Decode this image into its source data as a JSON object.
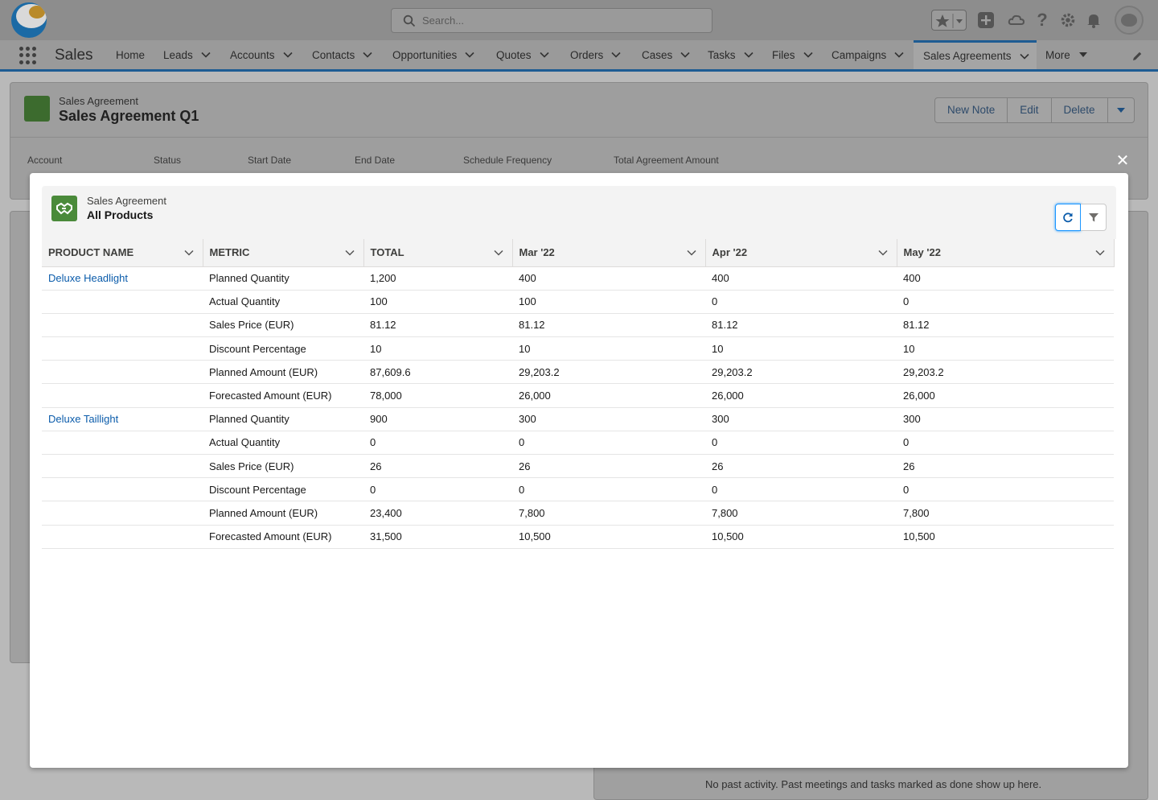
{
  "header": {
    "search_placeholder": "Search..."
  },
  "nav": {
    "app_name": "Sales",
    "items": [
      {
        "label": "Home",
        "has_menu": false
      },
      {
        "label": "Leads",
        "has_menu": true
      },
      {
        "label": "Accounts",
        "has_menu": true
      },
      {
        "label": "Contacts",
        "has_menu": true
      },
      {
        "label": "Opportunities",
        "has_menu": true
      },
      {
        "label": "Quotes",
        "has_menu": true
      },
      {
        "label": "Orders",
        "has_menu": true
      },
      {
        "label": "Cases",
        "has_menu": true
      },
      {
        "label": "Tasks",
        "has_menu": true
      },
      {
        "label": "Files",
        "has_menu": true
      },
      {
        "label": "Campaigns",
        "has_menu": true
      },
      {
        "label": "Sales Agreements",
        "has_menu": true,
        "active": true
      },
      {
        "label": "More",
        "has_menu": true
      }
    ]
  },
  "record": {
    "type_label": "Sales Agreement",
    "name": "Sales Agreement Q1",
    "actions": [
      "New Note",
      "Edit",
      "Delete"
    ],
    "fields": [
      "Account",
      "Status",
      "Start Date",
      "End Date",
      "Schedule Frequency",
      "Total Agreement Amount"
    ]
  },
  "activity": {
    "empty_text": "No past activity. Past meetings and tasks marked as done show up here."
  },
  "modal": {
    "type_label": "Sales Agreement",
    "title": "All Products",
    "columns": [
      "PRODUCT NAME",
      "METRIC",
      "TOTAL",
      "Mar '22",
      "Apr '22",
      "May '22"
    ],
    "rows": [
      {
        "product": "Deluxe Headlight",
        "metric": "Planned Quantity",
        "total": "1,200",
        "mar": "400",
        "apr": "400",
        "may": "400"
      },
      {
        "product": "",
        "metric": "Actual Quantity",
        "total": "100",
        "mar": "100",
        "apr": "0",
        "may": "0"
      },
      {
        "product": "",
        "metric": "Sales Price (EUR)",
        "total": "81.12",
        "mar": "81.12",
        "apr": "81.12",
        "may": "81.12"
      },
      {
        "product": "",
        "metric": "Discount Percentage",
        "total": "10",
        "mar": "10",
        "apr": "10",
        "may": "10"
      },
      {
        "product": "",
        "metric": "Planned Amount (EUR)",
        "total": "87,609.6",
        "mar": "29,203.2",
        "apr": "29,203.2",
        "may": "29,203.2"
      },
      {
        "product": "",
        "metric": "Forecasted Amount (EUR)",
        "total": "78,000",
        "mar": "26,000",
        "apr": "26,000",
        "may": "26,000"
      },
      {
        "product": "Deluxe Taillight",
        "metric": "Planned Quantity",
        "total": "900",
        "mar": "300",
        "apr": "300",
        "may": "300"
      },
      {
        "product": "",
        "metric": "Actual Quantity",
        "total": "0",
        "mar": "0",
        "apr": "0",
        "may": "0"
      },
      {
        "product": "",
        "metric": "Sales Price (EUR)",
        "total": "26",
        "mar": "26",
        "apr": "26",
        "may": "26"
      },
      {
        "product": "",
        "metric": "Discount Percentage",
        "total": "0",
        "mar": "0",
        "apr": "0",
        "may": "0"
      },
      {
        "product": "",
        "metric": "Planned Amount (EUR)",
        "total": "23,400",
        "mar": "7,800",
        "apr": "7,800",
        "may": "7,800"
      },
      {
        "product": "",
        "metric": "Forecasted Amount (EUR)",
        "total": "31,500",
        "mar": "10,500",
        "apr": "10,500",
        "may": "10,500"
      }
    ]
  },
  "colors": {
    "brand_blue": "#1b96ff",
    "link": "#0b5cab",
    "icon_green": "#4a8a3a"
  }
}
